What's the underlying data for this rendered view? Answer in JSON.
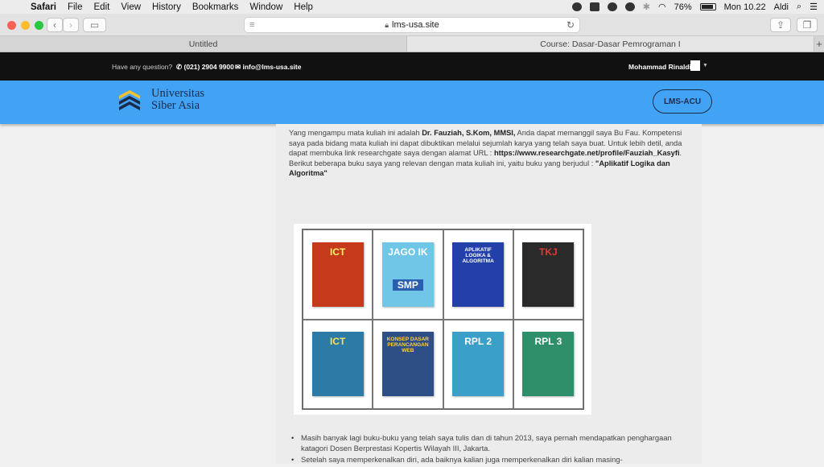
{
  "menubar": {
    "app": "Safari",
    "items": [
      "File",
      "Edit",
      "View",
      "History",
      "Bookmarks",
      "Window",
      "Help"
    ],
    "battery": "76%",
    "clock": "Mon 10.22",
    "user": "Aldi"
  },
  "browser": {
    "url": "lms-usa.site",
    "tabs": [
      {
        "label": "Untitled",
        "active": false
      },
      {
        "label": "Course: Dasar-Dasar Pemrograman I",
        "active": true
      }
    ],
    "new_tab": "+"
  },
  "topbar": {
    "question": "Have any question?",
    "phone": "(021) 2904 9900",
    "email": "info@lms-usa.site",
    "user_name": "Mohammad Rinaldi"
  },
  "header": {
    "brand_line1": "Universitas",
    "brand_line2": "Siber Asia",
    "button": "LMS-ACU",
    "color": "#42a3f5"
  },
  "content": {
    "intro_prefix": "Yang mengampu mata kuliah ini adalah ",
    "lecturer": "Dr. Fauziah, S.Kom, MMSI,",
    "intro_1": " Anda dapat memanggil saya Bu Fau. Kompetensi saya pada bidang mata kuliah ini dapat dibuktikan melalui sejumlah karya yang telah saya buat. Untuk lebih detil, anda dapat  membuka link researchgate saya dengan alamat URL : ",
    "url": "https://www.researchgate.net/profile/Fauziah_Kasyfi",
    "intro_2": ". Berikut beberapa buku saya yang relevan dengan mata kuliah ini, yaitu buku yang berjudul : ",
    "book_title": "\"Aplikatif Logika dan Algoritma\"",
    "books": [
      {
        "title": "ICT",
        "subtitle": "",
        "bg": "#c43a1a",
        "fg": "#fff36b"
      },
      {
        "title": "JAGO IK",
        "subtitle": "SMP",
        "bg": "#6fc6e6",
        "fg": "#fff"
      },
      {
        "title": "APLIKATIF LOGIKA & ALGORITMA",
        "subtitle": "",
        "bg": "#2340a8",
        "fg": "#fff"
      },
      {
        "title": "TKJ",
        "subtitle": "",
        "bg": "#2a2a2a",
        "fg": "#e23a2a"
      },
      {
        "title": "ICT",
        "subtitle": "",
        "bg": "#2c7aa6",
        "fg": "#f7e05a"
      },
      {
        "title": "KONSEP DASAR PERANCANGAN WEB",
        "subtitle": "",
        "bg": "#2e4e86",
        "fg": "#ffd23a"
      },
      {
        "title": "RPL 2",
        "subtitle": "",
        "bg": "#3aa0c8",
        "fg": "#fff"
      },
      {
        "title": "RPL 3",
        "subtitle": "",
        "bg": "#2f8f6a",
        "fg": "#fff"
      }
    ],
    "bullets": [
      "Masih banyak lagi buku-buku yang telah saya tulis dan di tahun 2013, saya pernah mendapatkan penghargaan katagori Dosen Berprestasi Kopertis Wilayah III, Jakarta.",
      "Setelah saya memperkenalkan diri, ada baiknya kalian juga memperkenalkan diri kalian masing-"
    ]
  }
}
